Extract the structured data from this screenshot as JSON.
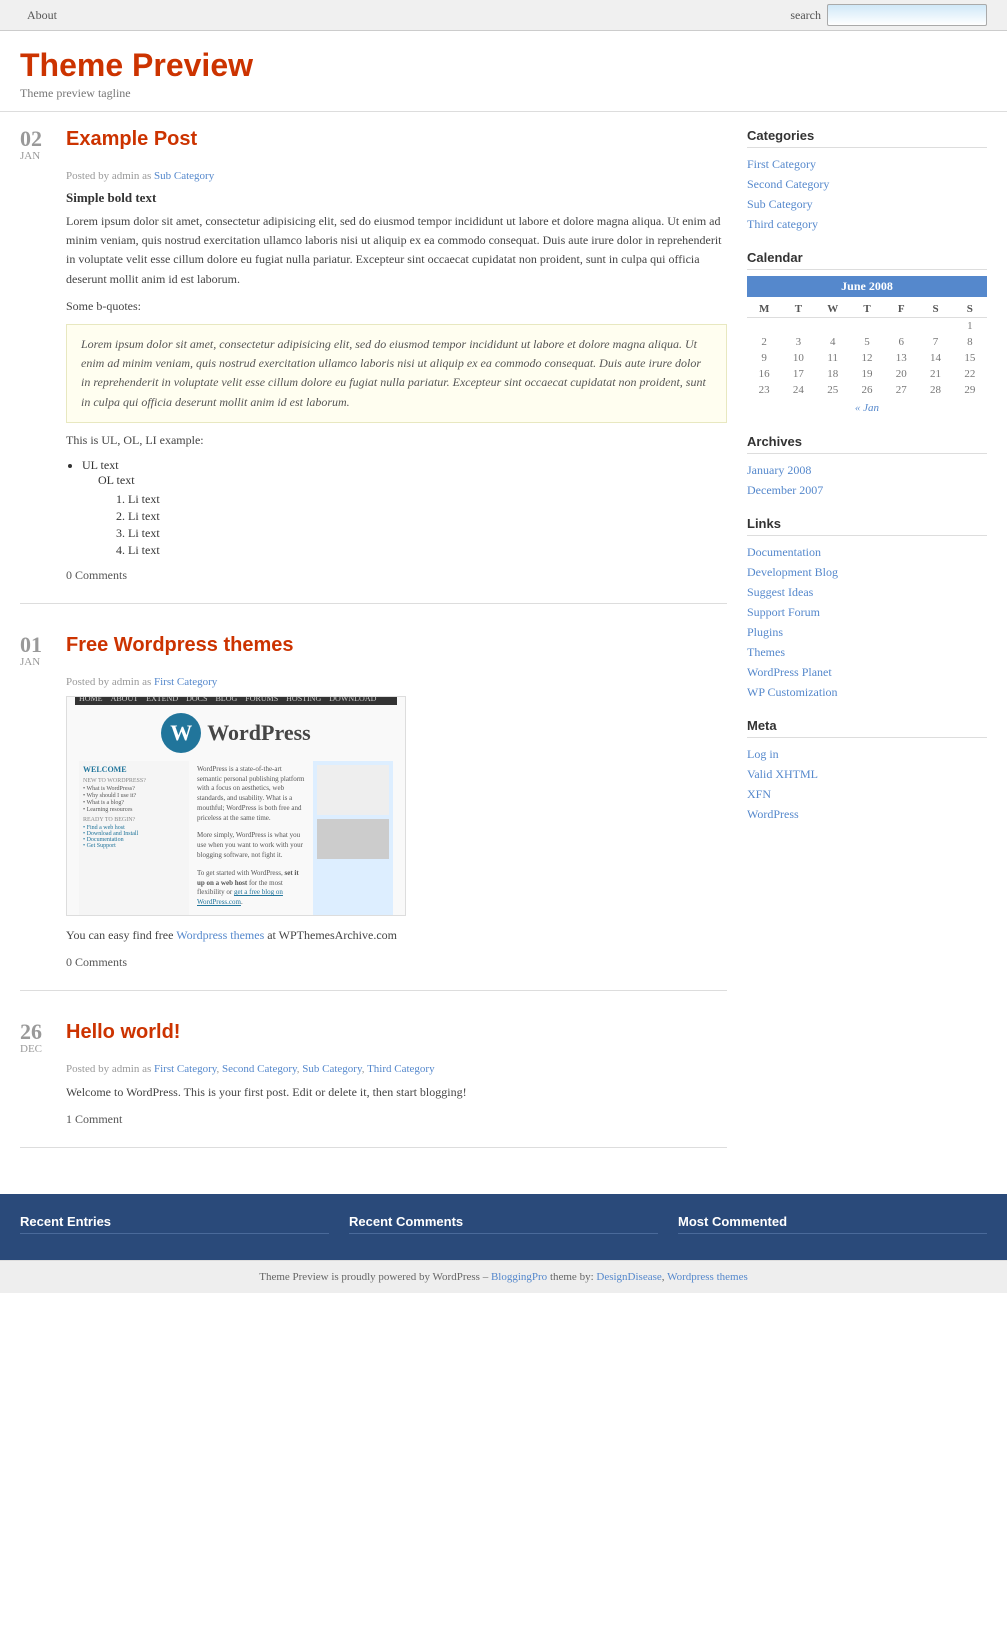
{
  "site": {
    "title": "Theme Preview",
    "tagline": "Theme preview tagline"
  },
  "topnav": {
    "links": [
      "About"
    ],
    "search_label": "search",
    "search_placeholder": ""
  },
  "sidebar": {
    "categories_title": "Categories",
    "categories": [
      {
        "label": "First Category",
        "href": "#"
      },
      {
        "label": "Second Category",
        "href": "#"
      },
      {
        "label": "Sub Category",
        "href": "#"
      },
      {
        "label": "Third category",
        "href": "#"
      }
    ],
    "archives_title": "Archives",
    "archives": [
      {
        "label": "January 2008",
        "href": "#"
      },
      {
        "label": "December 2007",
        "href": "#"
      }
    ],
    "links_title": "Links",
    "links": [
      {
        "label": "Documentation",
        "href": "#"
      },
      {
        "label": "Development Blog",
        "href": "#"
      },
      {
        "label": "Suggest Ideas",
        "href": "#"
      },
      {
        "label": "Support Forum",
        "href": "#"
      },
      {
        "label": "Plugins",
        "href": "#"
      },
      {
        "label": "Themes",
        "href": "#"
      },
      {
        "label": "WordPress Planet",
        "href": "#"
      },
      {
        "label": "WP Customization",
        "href": "#"
      }
    ],
    "meta_title": "Meta",
    "meta": [
      {
        "label": "Log in",
        "href": "#"
      },
      {
        "label": "Valid XHTML",
        "href": "#"
      },
      {
        "label": "XFN",
        "href": "#"
      },
      {
        "label": "WordPress",
        "href": "#"
      }
    ],
    "calendar": {
      "title": "Calendar",
      "month": "June 2008",
      "prev_label": "« Jan",
      "headers": [
        "M",
        "T",
        "W",
        "T",
        "F",
        "S",
        "S"
      ],
      "rows": [
        [
          "",
          "",
          "",
          "",
          "",
          "",
          "1"
        ],
        [
          "2",
          "3",
          "4",
          "5",
          "6",
          "7",
          "8"
        ],
        [
          "9",
          "10",
          "11",
          "12",
          "13",
          "14",
          "15"
        ],
        [
          "16",
          "17",
          "18",
          "19",
          "20",
          "21",
          "22"
        ],
        [
          "23",
          "24",
          "25",
          "26",
          "27",
          "28",
          "29"
        ]
      ]
    }
  },
  "posts": [
    {
      "day": "02",
      "month": "JAN",
      "title": "Example Post",
      "title_href": "#",
      "meta": "Posted by admin as",
      "categories": [
        {
          "label": "Sub Category",
          "href": "#"
        }
      ],
      "show_bold": true,
      "bold_text": "Simple bold text",
      "body_para": "Lorem ipsum dolor sit amet, consectetur adipisicing elit, sed do eiusmod tempor incididunt ut labore et dolore magna aliqua. Ut enim ad minim veniam, quis nostrud exercitation ullamco laboris nisi ut aliquip ex ea commodo consequat. Duis aute irure dolor in reprehenderit in voluptate velit esse cillum dolore eu fugiat nulla pariatur. Excepteur sint occaecat cupidatat non proident, sunt in culpa qui officia deserunt mollit anim id est laborum.",
      "bquote_label": "Some b-quotes:",
      "blockquote": "Lorem ipsum dolor sit amet, consectetur adipisicing elit, sed do eiusmod tempor incididunt ut labore et dolore magna aliqua. Ut enim ad minim veniam, quis nostrud exercitation ullamco laboris nisi ut aliquip ex ea commodo consequat. Duis aute irure dolor in reprehenderit in voluptate velit esse cillum dolore eu fugiat nulla pariatur. Excepteur sint occaecat cupidatat non proident, sunt in culpa qui officia deserunt mollit anim id est laborum.",
      "ul_label": "This is UL, OL, LI example:",
      "ul_items": [
        "UL text"
      ],
      "ol_parent": "OL text",
      "ol_items": [
        "Li text",
        "Li text",
        "Li text",
        "Li text"
      ],
      "comments_count": "0",
      "comments_label": "Comments"
    },
    {
      "day": "01",
      "month": "JAN",
      "title": "Free Wordpress themes",
      "title_href": "#",
      "meta": "Posted by admin as",
      "categories": [
        {
          "label": "First Category",
          "href": "#"
        }
      ],
      "show_bold": false,
      "has_screenshot": true,
      "free_text_pre": "You can easy find free",
      "free_text_link": "Wordpress themes",
      "free_text_post": "at WPThemesArchive.com",
      "comments_count": "0",
      "comments_label": "Comments"
    },
    {
      "day": "26",
      "month": "DEC",
      "title": "Hello world!",
      "title_href": "#",
      "meta": "Posted by admin as",
      "categories": [
        {
          "label": "First Category",
          "href": "#"
        },
        {
          "label": "Second Category",
          "href": "#"
        },
        {
          "label": "Sub Category",
          "href": "#"
        },
        {
          "label": "Third Category",
          "href": "#"
        }
      ],
      "show_bold": false,
      "body_para": "Welcome to WordPress. This is your first post. Edit or delete it, then start blogging!",
      "comments_count": "1",
      "comments_label": "Comment"
    }
  ],
  "footer": {
    "sections": [
      {
        "title": "Recent Entries"
      },
      {
        "title": "Recent Comments"
      },
      {
        "title": "Most Commented"
      }
    ],
    "bottom_text": "Theme Preview is proudly powered by WordPress –",
    "bottom_link1_label": "BloggingPro",
    "bottom_text2": "theme by:",
    "bottom_link2_label": "DesignDisease",
    "bottom_link3_label": "Wordpress themes"
  }
}
